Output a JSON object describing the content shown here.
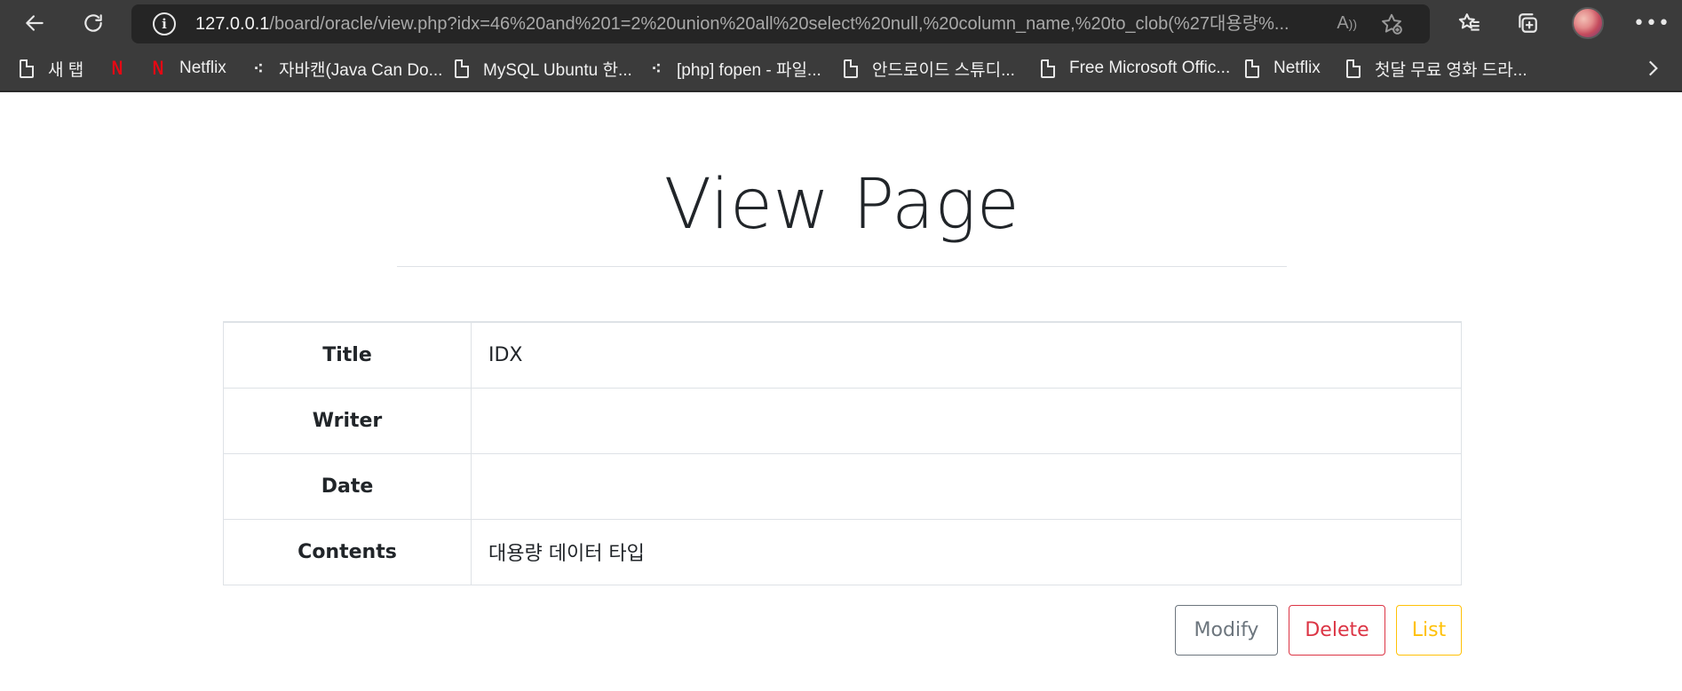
{
  "browser": {
    "url_host": "127.0.0.1",
    "url_rest": "/board/oracle/view.php?idx=46%20and%201=2%20union%20all%20select%20null,%20column_name,%20to_clob(%27대용량%...",
    "read_aloud_label": "Aʘ",
    "more_label": "•••",
    "bookmarks": [
      {
        "label": "새 탭",
        "icon": "page-icon"
      },
      {
        "label": "",
        "icon": "netflix-icon"
      },
      {
        "label": "Netflix",
        "icon": "netflix-icon"
      },
      {
        "label": "자바캔(Java Can Do...",
        "icon": "tistory-icon"
      },
      {
        "label": "MySQL Ubuntu 한...",
        "icon": "page-icon"
      },
      {
        "label": "[php] fopen - 파일...",
        "icon": "tistory-icon"
      },
      {
        "label": "안드로이드 스튜디...",
        "icon": "page-icon"
      },
      {
        "label": "Free Microsoft Offic...",
        "icon": "page-icon"
      },
      {
        "label": "Netflix",
        "icon": "page-icon"
      },
      {
        "label": "첫달 무료 영화 드라...",
        "icon": "page-icon"
      }
    ]
  },
  "page": {
    "title": "View Page",
    "rows": [
      {
        "label": "Title",
        "value": "IDX"
      },
      {
        "label": "Writer",
        "value": ""
      },
      {
        "label": "Date",
        "value": ""
      },
      {
        "label": "Contents",
        "value": "대용량 데이터 타입"
      }
    ],
    "buttons": {
      "modify": "Modify",
      "delete": "Delete",
      "list": "List"
    }
  },
  "colors": {
    "modify": "#6c757d",
    "delete": "#dc3545",
    "list": "#ffc107",
    "chrome": "#3b3b3b"
  }
}
